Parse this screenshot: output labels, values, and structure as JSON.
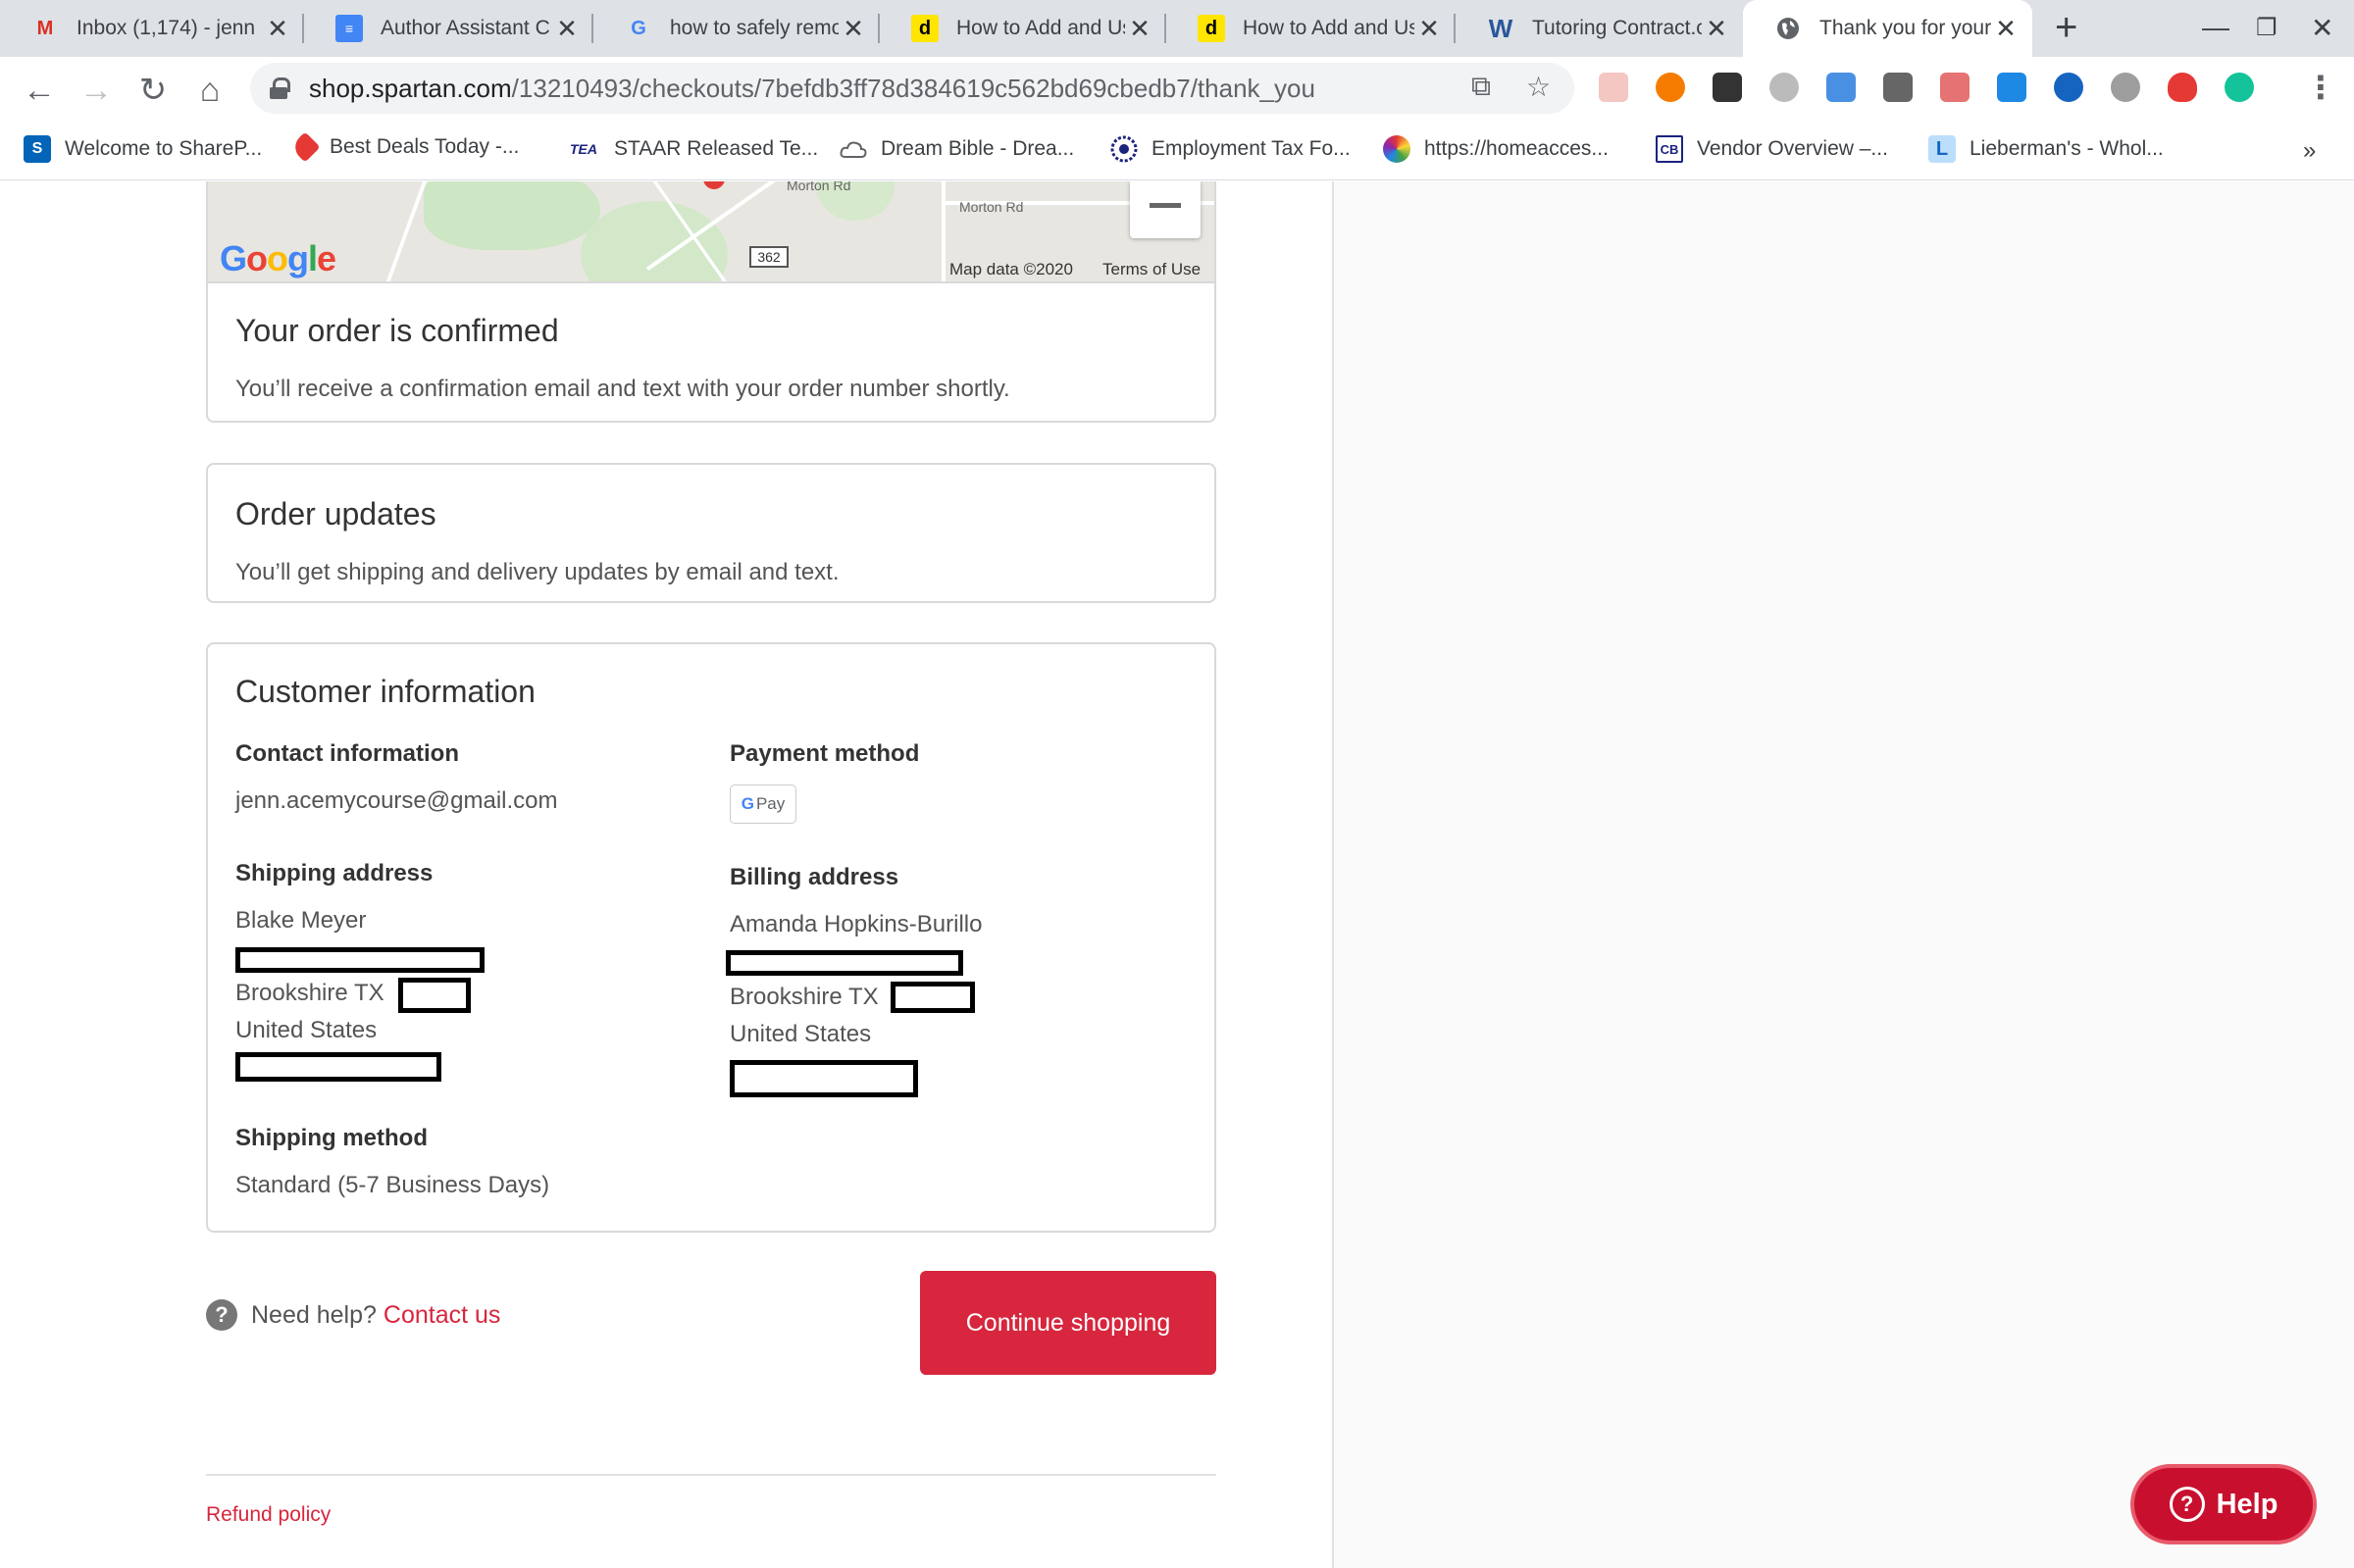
{
  "tabs": [
    {
      "title": "Inbox (1,174) - jenn",
      "icon": "gmail-icon",
      "active": false
    },
    {
      "title": "Author Assistant C",
      "icon": "docs-icon",
      "active": false
    },
    {
      "title": "how to safely remo",
      "icon": "google-icon",
      "active": false
    },
    {
      "title": "How to Add and Us",
      "icon": "d-icon",
      "active": false
    },
    {
      "title": "How to Add and Us",
      "icon": "d-icon",
      "active": false
    },
    {
      "title": "Tutoring Contract.c",
      "icon": "word-icon",
      "active": false
    },
    {
      "title": "Thank you for your",
      "icon": "globe-icon",
      "active": true
    }
  ],
  "address_bar": {
    "host": "shop.spartan.com",
    "path": "/13210493/checkouts/7befdb3ff78d384619c562bd69cbedb7/thank_you"
  },
  "bookmarks": [
    {
      "label": "Welcome to ShareP...",
      "icon": "sharepoint-icon",
      "color": "#0364b8",
      "glyph": "S"
    },
    {
      "label": "Best Deals Today -...",
      "icon": "tag-icon",
      "color": "#e53935",
      "glyph": ""
    },
    {
      "label": "STAAR Released Te...",
      "icon": "tea-icon",
      "color": "#ffffff",
      "glyph": "TEA"
    },
    {
      "label": "Dream Bible - Drea...",
      "icon": "cloud-icon",
      "color": "#ffffff",
      "glyph": ""
    },
    {
      "label": "Employment Tax Fo...",
      "icon": "irs-icon",
      "color": "#ffffff",
      "glyph": ""
    },
    {
      "label": "https://homeacces...",
      "icon": "colorwheel-icon",
      "color": "#8e24aa",
      "glyph": ""
    },
    {
      "label": "Vendor Overview –...",
      "icon": "cb-icon",
      "color": "#ffffff",
      "glyph": "CB"
    },
    {
      "label": "Lieberman's - Whol...",
      "icon": "l-icon",
      "color": "#90caf9",
      "glyph": "L"
    }
  ],
  "map": {
    "labels": [
      "Morton Rd",
      "Morton Rd"
    ],
    "route": "362",
    "logo": "Google",
    "map_data": "Map data ©2020",
    "terms": "Terms of Use"
  },
  "confirmed": {
    "title": "Your order is confirmed",
    "text": "You’ll receive a confirmation email and text with your order number shortly."
  },
  "updates": {
    "title": "Order updates",
    "text": "You’ll get shipping and delivery updates by email and text."
  },
  "customer": {
    "title": "Customer information",
    "contact_heading": "Contact information",
    "contact_email": "jenn.acemycourse@gmail.com",
    "payment_heading": "Payment method",
    "payment_badge": "Pay",
    "payment_badge_g": "G",
    "shipping_heading": "Shipping address",
    "shipping_name": "Blake Meyer",
    "shipping_city": "Brookshire TX",
    "shipping_country": "United States",
    "billing_heading": "Billing address",
    "billing_name": "Amanda Hopkins-Burillo",
    "billing_city": "Brookshire TX",
    "billing_country": "United States",
    "method_heading": "Shipping method",
    "method_value": "Standard (5-7 Business Days)"
  },
  "footer": {
    "need_help": "Need help?",
    "contact_link": "Contact us",
    "continue_button": "Continue shopping",
    "refund_policy": "Refund policy",
    "help_button": "Help"
  },
  "colors": {
    "brand_red": "#d7263d",
    "help_red": "#c8102e"
  }
}
